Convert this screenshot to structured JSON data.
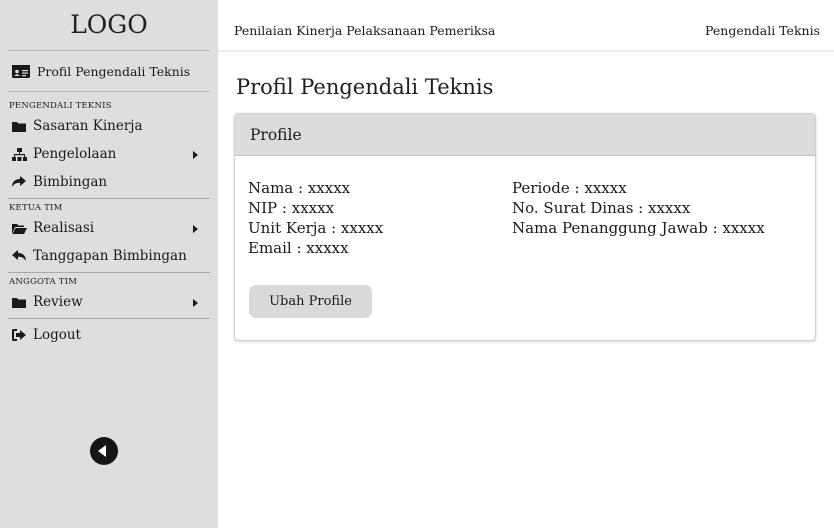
{
  "sidebar": {
    "logo": "LOGO",
    "profile_link": "Profil Pengendali Teknis",
    "sections": [
      {
        "title": "PENGENDALI TEKNIS",
        "items": [
          {
            "label": "Sasaran Kinerja",
            "icon": "folder-icon"
          },
          {
            "label": "Pengelolaan",
            "icon": "sitemap-icon",
            "has_submenu": true
          },
          {
            "label": "Bimbingan",
            "icon": "share-arrow-icon"
          }
        ]
      },
      {
        "title": "KETUA TIM",
        "items": [
          {
            "label": "Realisasi",
            "icon": "folder-open-icon",
            "has_submenu": true
          },
          {
            "label": "Tanggapan Bimbingan",
            "icon": "reply-icon"
          }
        ]
      },
      {
        "title": "ANGGOTA TIM",
        "items": [
          {
            "label": "Review",
            "icon": "folder-icon",
            "has_submenu": true
          }
        ]
      }
    ],
    "logout": "Logout"
  },
  "topbar": {
    "title": "Penilaian Kinerja Pelaksanaan Pemeriksa",
    "role": "Pengendali Teknis"
  },
  "page_title": "Profil Pengendali Teknis",
  "card": {
    "header": "Profile",
    "left_fields": [
      "Nama :  xxxxx",
      "NIP : xxxxx",
      "Unit Kerja : xxxxx",
      "Email : xxxxx"
    ],
    "right_fields": [
      "Periode : xxxxx",
      "No. Surat Dinas : xxxxx",
      "Nama Penanggung Jawab : xxxxx"
    ],
    "button": "Ubah Profile"
  }
}
